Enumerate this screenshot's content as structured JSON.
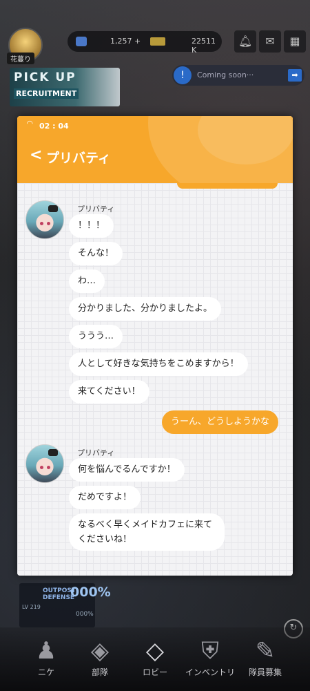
{
  "background": {
    "player_name": "花蔓り",
    "currency1": "1,257 +",
    "currency2": "22511 K",
    "top_icons": [
      "bell-icon",
      "mail-icon",
      "grid-icon"
    ],
    "banner_line1": "PICK UP",
    "banner_line2": "RECRUITMENT",
    "notice_text": "Coming soon···",
    "outpost_label_1": "OUTPOST",
    "outpost_label_2": "DEFENSE",
    "outpost_percent": "000%",
    "outpost_level": "LV 219",
    "outpost_percent_small": "000%",
    "nav": [
      {
        "label": "ニケ",
        "icon": "nikke-icon"
      },
      {
        "label": "部隊",
        "icon": "squad-icon"
      },
      {
        "label": "ロビー",
        "icon": "lobby-icon"
      },
      {
        "label": "インベントリ",
        "icon": "inventory-icon"
      },
      {
        "label": "隊員募集",
        "icon": "recruit-icon"
      }
    ]
  },
  "chat_window": {
    "time": "02 : 04",
    "title": "プリバティ",
    "back_glyph": "<",
    "messages": [
      {
        "from": "プリバティ",
        "side": "left",
        "texts": [
          "！！！",
          "そんな！",
          "わ…",
          "分かりました、分かりましたよ。",
          "ううう…",
          "人として好きな気持ちをこめますから！",
          "来てください！"
        ]
      },
      {
        "from": "me",
        "side": "right",
        "texts": [
          "うーん、どうしようかな"
        ]
      },
      {
        "from": "プリバティ",
        "side": "left",
        "texts": [
          "何を悩んでるんですか！",
          "だめですよ！",
          "なるべく早くメイドカフェに来てくださいね！"
        ]
      }
    ]
  }
}
